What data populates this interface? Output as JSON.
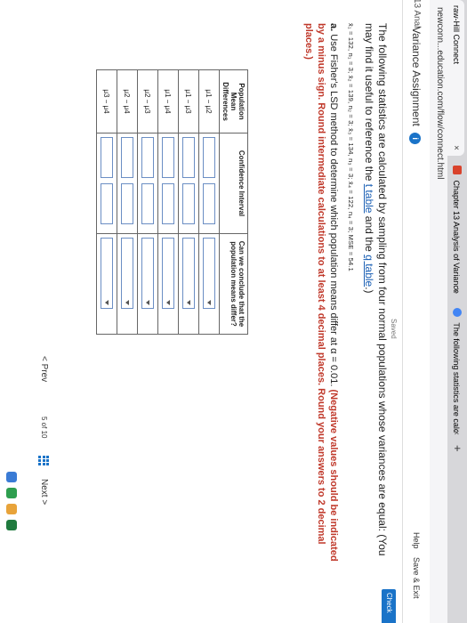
{
  "browser": {
    "tabs": [
      {
        "label": "raw-Hill Connect",
        "active": true
      },
      {
        "label": "Chapter 13 Analysis of Variance",
        "active": false
      },
      {
        "label": "The following statistics are calc",
        "active": false
      }
    ],
    "new_tab": "+",
    "close_glyph": "×",
    "url": "newconn...education.com/flow/connect.html"
  },
  "header": {
    "breadcrumb": "13 Anal",
    "title": "Variance Assignment",
    "info_icon": "i",
    "help": "Help",
    "save_exit": "Save & Exit",
    "saved": "Saved",
    "check": "Check"
  },
  "question": {
    "intro_part1": "The following statistics are calculated by sampling from four normal populations whose variances are equal: (You may find it useful to reference the ",
    "t_table_link": "t table",
    "intro_and": " and the ",
    "q_table_link": "q table",
    "intro_end": ".)",
    "data_line": "x̄₁ = 132, n₁ = 3; x̄₂ = 139, n₂ = 3; x̄₃ = 134, n₃ = 3; x̄₄ = 122, n₄ = 3; MSE = 54.1",
    "part_a_label": "a.",
    "part_a_text": " Use Fisher's LSD method to determine which population means differ at α = 0.01. ",
    "part_a_red": "(Negative values should be indicated by a minus sign. Round intermediate calculations to at least 4 decimal places. Round your answers to 2 decimal places.)"
  },
  "table": {
    "headers": [
      "Population Mean Differences",
      "Confidence Interval",
      "Can we conclude that the population means differ?"
    ],
    "rows": [
      {
        "diff": "μ1 − μ2"
      },
      {
        "diff": "μ1 − μ3"
      },
      {
        "diff": "μ1 − μ4"
      },
      {
        "diff": "μ2 − μ3"
      },
      {
        "diff": "μ2 − μ4"
      },
      {
        "diff": "μ3 − μ4"
      }
    ]
  },
  "pager": {
    "prev": "< Prev",
    "page_info": "5 of 10",
    "next": "Next >"
  },
  "colors": {
    "accent": "#1a73c8",
    "link": "#1a5fb4",
    "warning": "#c0392b"
  }
}
